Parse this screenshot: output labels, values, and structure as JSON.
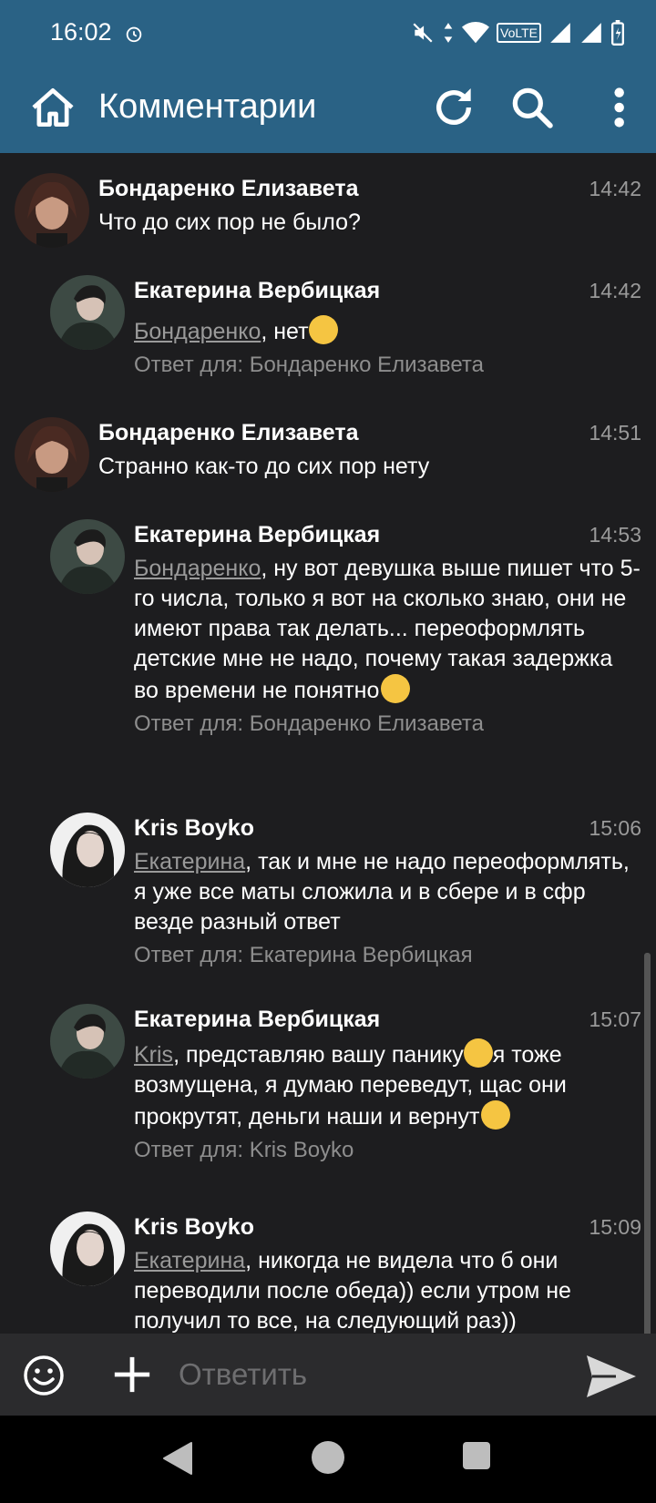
{
  "status_bar": {
    "time": "16:02",
    "volte_label": "VoLTE"
  },
  "app_bar": {
    "title": "Комментарии"
  },
  "comments": [
    {
      "author": "Бондаренко Елизавета",
      "time": "14:42",
      "text": "Что до сих пор не было?"
    },
    {
      "author": "Екатерина Вербицкая",
      "time": "14:42",
      "mention": "Бондаренко",
      "text": ", нет",
      "reply_to": "Ответ для: Бондаренко Елизавета"
    },
    {
      "author": "Бондаренко Елизавета",
      "time": "14:51",
      "text": "Странно как-то до сих пор нету"
    },
    {
      "author": "Екатерина Вербицкая",
      "time": "14:53",
      "mention": "Бондаренко",
      "text": ", ну вот девушка выше пишет что 5-го числа, только я вот на сколько знаю, они не имеют права так делать... переоформлять детские мне не надо, почему такая задержка во времени не понятно",
      "reply_to": "Ответ для: Бондаренко Елизавета"
    },
    {
      "author": "Kris Boyko",
      "time": "15:06",
      "mention": "Екатерина",
      "text": ", так и мне не надо переоформлять, я уже все маты сложила и в сбере и в сфр везде разный ответ",
      "reply_to": "Ответ для: Екатерина Вербицкая"
    },
    {
      "author": "Екатерина Вербицкая",
      "time": "15:07",
      "mention": "Kris",
      "text": ", представляю вашу панику",
      "text_2": "я тоже возмущена, я думаю переведут, щас они прокрутят, деньги наши и вернут",
      "reply_to": "Ответ для: Kris Boyko"
    },
    {
      "author": "Kris Boyko",
      "time": "15:09",
      "mention": "Екатерина",
      "text": ", никогда не видела что б они переводили после обеда)) если утром не получил то все, на следующий раз))"
    }
  ],
  "reply_bar": {
    "placeholder": "Ответить"
  },
  "colors": {
    "app_bar": "#2a6285",
    "background": "#1d1d1f",
    "muted_text": "#9a9a9a"
  }
}
